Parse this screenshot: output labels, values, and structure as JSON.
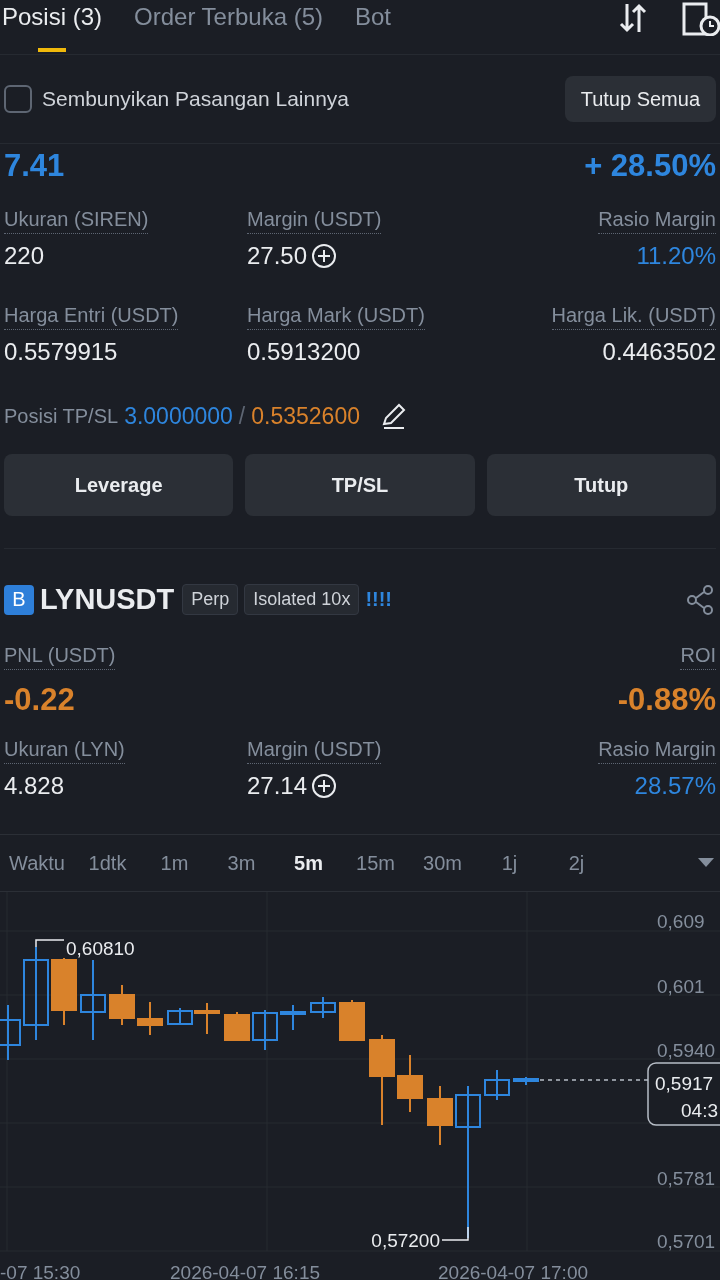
{
  "tabs": [
    {
      "label": "Posisi (3)",
      "selected": true
    },
    {
      "label": "Order Terbuka (5)",
      "selected": false
    },
    {
      "label": "Bot",
      "selected": false
    }
  ],
  "hide_others": {
    "label": "Sembunyikan Pasangan Lainnya",
    "checked": false
  },
  "close_all_button": "Tutup Semua",
  "positions": [
    {
      "positive": true,
      "pnl": "7.41",
      "roi": "+ 28.50%",
      "fields": [
        {
          "label": "Ukuran (SIREN)",
          "value": "220",
          "kind": "plain"
        },
        {
          "label": "Margin (USDT)",
          "value": "27.50",
          "kind": "addable"
        },
        {
          "label": "Rasio Margin",
          "value": "11.20%",
          "kind": "accent"
        },
        {
          "label": "Harga Entri (USDT)",
          "value": "0.5579915",
          "kind": "plain"
        },
        {
          "label": "Harga Mark (USDT)",
          "value": "0.5913200",
          "kind": "plain"
        },
        {
          "label": "Harga Lik. (USDT)",
          "value": "0.4463502",
          "kind": "plain"
        }
      ],
      "tpsl": {
        "label": "Posisi TP/SL",
        "tp": "3.0000000",
        "separator": "/",
        "sl": "0.5352600"
      },
      "buttons": [
        "Leverage",
        "TP/SL",
        "Tutup"
      ]
    },
    {
      "positive": false,
      "badge": "B",
      "symbol": "LYNUSDT",
      "tags": [
        "Perp",
        "Isolated 10x"
      ],
      "signal": "!!!!",
      "pnl_label": "PNL (USDT)",
      "roi_label": "ROI",
      "pnl": "-0.22",
      "roi": "-0.88%",
      "fields": [
        {
          "label": "Ukuran (LYN)",
          "value": "4.828",
          "kind": "plain"
        },
        {
          "label": "Margin (USDT)",
          "value": "27.14",
          "kind": "addable"
        },
        {
          "label": "Rasio Margin",
          "value": "28.57%",
          "kind": "accent"
        }
      ]
    }
  ],
  "timeframes": [
    {
      "label": "Waktu",
      "selected": false
    },
    {
      "label": "1dtk",
      "selected": false
    },
    {
      "label": "1m",
      "selected": false
    },
    {
      "label": "3m",
      "selected": false
    },
    {
      "label": "5m",
      "selected": true
    },
    {
      "label": "15m",
      "selected": false
    },
    {
      "label": "30m",
      "selected": false
    },
    {
      "label": "1j",
      "selected": false
    },
    {
      "label": "2j",
      "selected": false
    }
  ],
  "chart": {
    "y_labels": [
      "0,609",
      "0,601",
      "0,5940",
      "0,5781",
      "0,5701"
    ],
    "x_labels": [
      "-07 15:30",
      "2026-04-07 16:15",
      "2026-04-07 17:00"
    ],
    "high_label": "0,60810",
    "low_label": "0,57200",
    "price_tag": {
      "price": "0,5917",
      "countdown": "04:3"
    }
  }
}
